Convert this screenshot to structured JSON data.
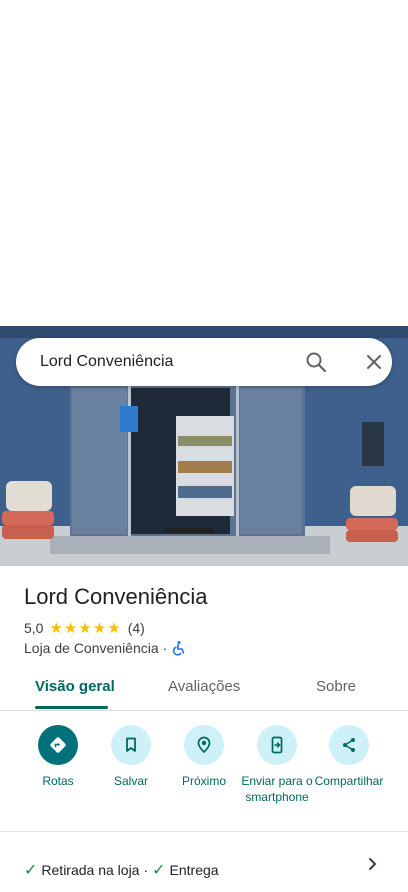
{
  "search": {
    "query": "Lord Conveniência"
  },
  "place": {
    "name": "Lord Conveniência",
    "rating": "5,0",
    "stars": "★★★★★",
    "review_count": "(4)",
    "category": "Loja de Conveniência",
    "separator": "·"
  },
  "tabs": [
    {
      "label": "Visão geral"
    },
    {
      "label": "Avaliações"
    },
    {
      "label": "Sobre"
    }
  ],
  "actions": [
    {
      "label": "Rotas"
    },
    {
      "label": "Salvar"
    },
    {
      "label": "Próximo"
    },
    {
      "label": "Enviar para o smartphone"
    },
    {
      "label": "Compartilhar"
    }
  ],
  "amenities": {
    "items": [
      "Retirada na loja",
      "Entrega"
    ],
    "separator": "·"
  },
  "colors": {
    "accent": "#00695c",
    "action_bg": "#cdf1f7",
    "primary_action": "#00707a",
    "star": "#fbbc04",
    "check": "#1e8e3e"
  }
}
